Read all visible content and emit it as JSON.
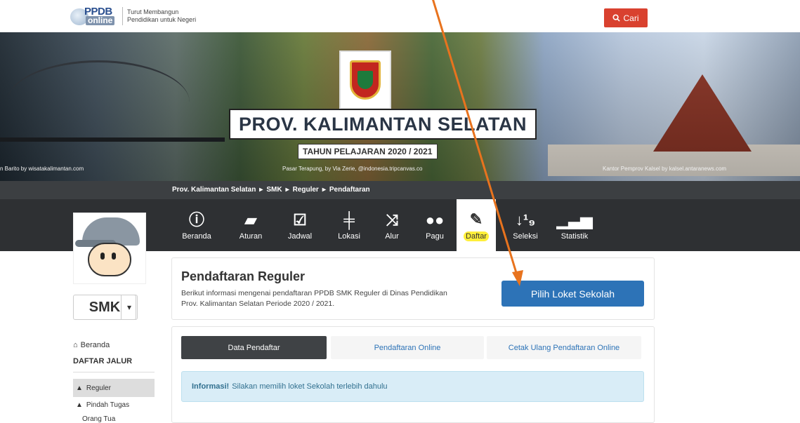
{
  "header": {
    "logo_top": "PPDB",
    "logo_bottom": "online",
    "tagline_1": "Turut Membangun",
    "tagline_2": "Pendidikan untuk Negeri",
    "search_label": "Cari"
  },
  "banner": {
    "title": "PROV. KALIMANTAN SELATAN",
    "year": "TAHUN PELAJARAN 2020 / 2021",
    "caption_left": "n Barito by wisatakalimantan.com",
    "caption_center": "Pasar Terapung, by Via Zerie, @indonesia.tripcanvas.co",
    "caption_right": "Kantor Pemprov Kalsel by kalsel.antaranews.com"
  },
  "breadcrumb": [
    "Prov. Kalimantan Selatan",
    "SMK",
    "Reguler",
    "Pendaftaran"
  ],
  "nav": [
    {
      "label": "Beranda",
      "icon": "info-icon"
    },
    {
      "label": "Aturan",
      "icon": "book-icon"
    },
    {
      "label": "Jadwal",
      "icon": "calendar-check-icon"
    },
    {
      "label": "Lokasi",
      "icon": "signpost-icon"
    },
    {
      "label": "Alur",
      "icon": "shuffle-icon"
    },
    {
      "label": "Pagu",
      "icon": "users-icon"
    },
    {
      "label": "Daftar",
      "icon": "pencil-icon"
    },
    {
      "label": "Seleksi",
      "icon": "sort-numeric-icon"
    },
    {
      "label": "Statistik",
      "icon": "bar-chart-icon"
    }
  ],
  "sidebar": {
    "level": "SMK",
    "home": "Beranda",
    "heading": "DAFTAR JALUR",
    "items": [
      "Reguler",
      "Pindah Tugas"
    ],
    "sub": "Orang Tua"
  },
  "main": {
    "title": "Pendaftaran Reguler",
    "desc_1": "Berikut informasi mengenai pendaftaran PPDB SMK Reguler di Dinas Pendidikan",
    "desc_2": "Prov. Kalimantan Selatan Periode 2020 / 2021.",
    "action": "Pilih Loket Sekolah",
    "tabs": [
      "Data Pendaftar",
      "Pendaftaran Online",
      "Cetak Ulang Pendaftaran Online"
    ],
    "info_label": "Informasi!",
    "info_text": "Silakan memilih loket Sekolah terlebih dahulu"
  },
  "colors": {
    "accent": "#2d73b7",
    "search": "#d9412f",
    "annotation": "#e8731e",
    "highlight": "#ffef3a"
  }
}
